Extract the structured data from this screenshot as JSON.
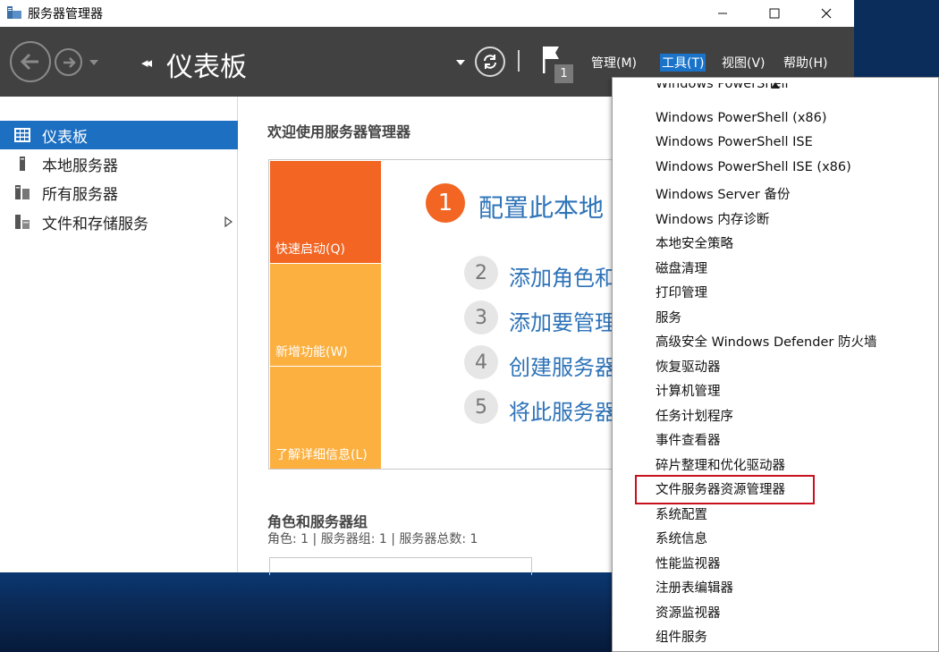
{
  "window": {
    "title": "服务器管理器",
    "controls": {
      "minimize": "—",
      "maximize": "☐",
      "close": "✕"
    }
  },
  "header": {
    "breadcrumb": "仪表板",
    "notification_count": "1",
    "menus": [
      "管理(M)",
      "工具(T)",
      "视图(V)",
      "帮助(H)"
    ],
    "active_menu": "工具(T)"
  },
  "nav": {
    "items": [
      {
        "label": "仪表板",
        "icon": "dashboard-icon",
        "active": true
      },
      {
        "label": "本地服务器",
        "icon": "server-icon"
      },
      {
        "label": "所有服务器",
        "icon": "servers-icon"
      },
      {
        "label": "文件和存储服务",
        "icon": "storage-icon",
        "has_arrow": true
      }
    ]
  },
  "main": {
    "welcome_title": "欢迎使用服务器管理器",
    "tiles": [
      {
        "label": "快速启动(Q)",
        "color": "#f26522"
      },
      {
        "label": "新增功能(W)",
        "color": "#fbb040"
      },
      {
        "label": "了解详细信息(L)",
        "color": "#fbb040"
      }
    ],
    "steps": [
      {
        "num": "1",
        "text": "配置此本地"
      },
      {
        "num": "2",
        "text": "添加角色和"
      },
      {
        "num": "3",
        "text": "添加要管理"
      },
      {
        "num": "4",
        "text": "创建服务器"
      },
      {
        "num": "5",
        "text": "将此服务器"
      }
    ],
    "roles_title": "角色和服务器组",
    "roles_subtitle": "角色: 1 | 服务器组: 1 | 服务器总数: 1"
  },
  "tools_menu": {
    "items": [
      "Windows PowerShell",
      "Windows PowerShell (x86)",
      "Windows PowerShell ISE",
      "Windows PowerShell ISE (x86)",
      "Windows Server 备份",
      "Windows 内存诊断",
      "本地安全策略",
      "磁盘清理",
      "打印管理",
      "服务",
      "高级安全 Windows Defender 防火墙",
      "恢复驱动器",
      "计算机管理",
      "任务计划程序",
      "事件查看器",
      "碎片整理和优化驱动器",
      "文件服务器资源管理器",
      "系统配置",
      "系统信息",
      "性能监视器",
      "注册表编辑器",
      "资源监视器",
      "组件服务"
    ],
    "highlighted": "文件服务器资源管理器"
  },
  "colors": {
    "header_bg": "#414141",
    "accent": "#1d6fc1",
    "highlight_border": "#c8101e"
  }
}
